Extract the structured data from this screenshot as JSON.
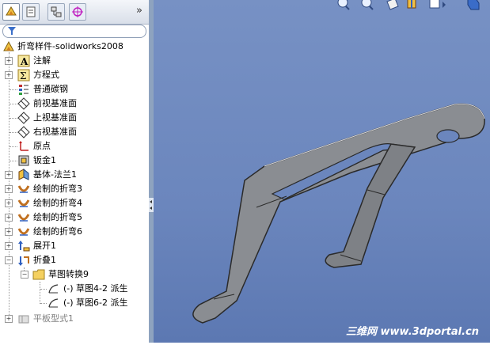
{
  "tree": {
    "root_label": "折弯样件-solidworks2008",
    "items": [
      {
        "label": "注解"
      },
      {
        "label": "方程式"
      },
      {
        "label": "普通碳钢"
      },
      {
        "label": "前视基准面"
      },
      {
        "label": "上视基准面"
      },
      {
        "label": "右视基准面"
      },
      {
        "label": "原点"
      },
      {
        "label": "钣金1"
      },
      {
        "label": "基体-法兰1"
      },
      {
        "label": "绘制的折弯3"
      },
      {
        "label": "绘制的折弯4"
      },
      {
        "label": "绘制的折弯5"
      },
      {
        "label": "绘制的折弯6"
      },
      {
        "label": "展开1"
      },
      {
        "label": "折叠1"
      },
      {
        "label": "草图转换9"
      },
      {
        "label": "(-) 草图4-2 派生"
      },
      {
        "label": "(-) 草图6-2 派生"
      },
      {
        "label": "平板型式1"
      }
    ]
  },
  "toolbar": {
    "more": "»"
  },
  "watermark": "三维网 www.3dportal.cn",
  "colors": {
    "viewport_top": "#7791c4",
    "viewport_bottom": "#5c78b2",
    "part_face": "#8a8d92",
    "part_edge": "#2a2a2a"
  }
}
